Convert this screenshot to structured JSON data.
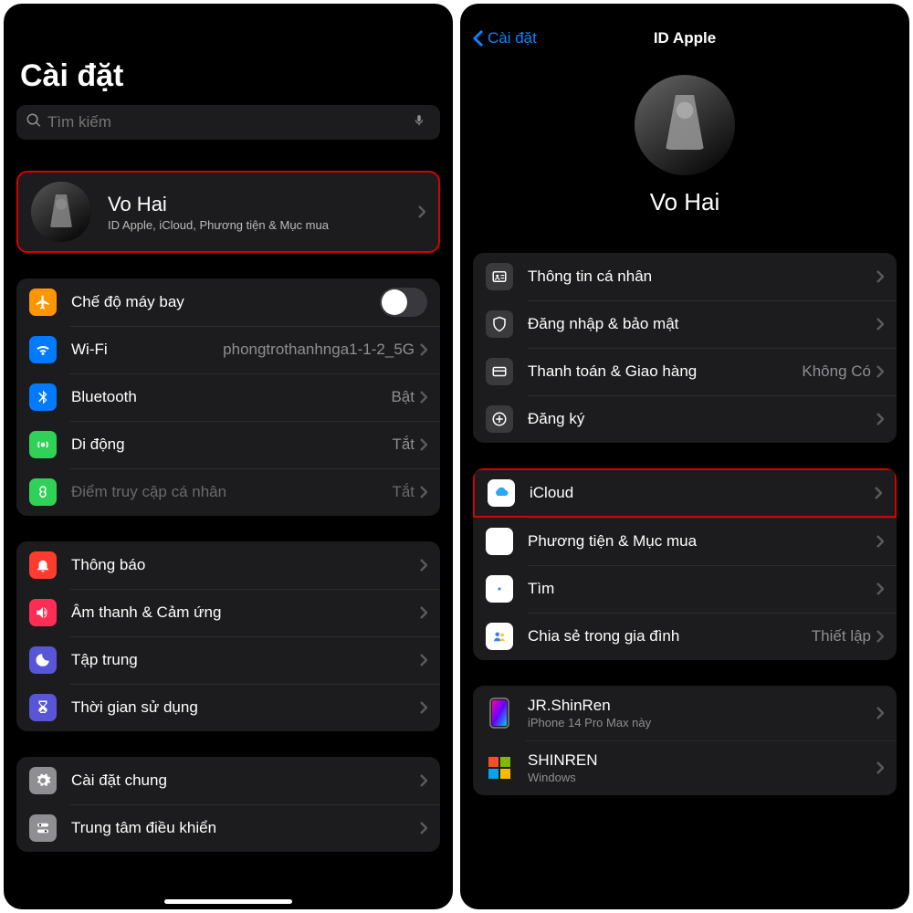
{
  "left": {
    "title": "Cài đặt",
    "search_placeholder": "Tìm kiếm",
    "apple_id": {
      "name": "Vo Hai",
      "subtitle": "ID Apple, iCloud, Phương tiện & Mục mua"
    },
    "g1": {
      "airplane": "Chế độ máy bay",
      "wifi": "Wi-Fi",
      "wifi_value": "phongtrothanhnga1-1-2_5G",
      "bluetooth": "Bluetooth",
      "bluetooth_value": "Bật",
      "cellular": "Di động",
      "cellular_value": "Tắt",
      "hotspot": "Điểm truy cập cá nhân",
      "hotspot_value": "Tắt"
    },
    "g2": {
      "notifications": "Thông báo",
      "sounds": "Âm thanh & Cảm ứng",
      "focus": "Tập trung",
      "screentime": "Thời gian sử dụng"
    },
    "g3": {
      "general": "Cài đặt chung",
      "control": "Trung tâm điều khiển"
    }
  },
  "right": {
    "back": "Cài đặt",
    "title": "ID Apple",
    "name": "Vo Hai",
    "sec1": {
      "personal": "Thông tin cá nhân",
      "signin": "Đăng nhập & bảo mật",
      "payment": "Thanh toán & Giao hàng",
      "payment_value": "Không Có",
      "subs": "Đăng ký"
    },
    "sec2": {
      "icloud": "iCloud",
      "media": "Phương tiện & Mục mua",
      "find": "Tìm",
      "family": "Chia sẻ trong gia đình",
      "family_value": "Thiết lập"
    },
    "devices": {
      "d1_name": "JR.ShinRen",
      "d1_sub": "iPhone 14 Pro Max này",
      "d2_name": "SHINREN",
      "d2_sub": "Windows"
    }
  }
}
